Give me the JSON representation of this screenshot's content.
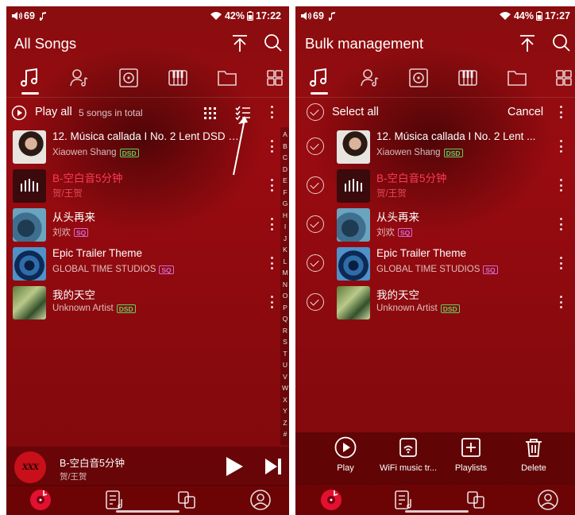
{
  "left": {
    "status": {
      "volume": "69",
      "battery": "42%",
      "time": "17:22"
    },
    "title": "All Songs",
    "subbar": {
      "play_all": "Play all",
      "count": "5 songs in total"
    },
    "songs": [
      {
        "title": "12. Música callada I No. 2  Lent DSD 5...",
        "artist": "Xiaowen Shang",
        "badge": "DSD",
        "playing": false
      },
      {
        "title": "B-空白音5分钟",
        "artist": "贺/王贺",
        "badge": "",
        "playing": true
      },
      {
        "title": "从头再来",
        "artist": "刘欢",
        "badge": "SQ",
        "playing": false
      },
      {
        "title": "Epic Trailer Theme",
        "artist": "GLOBAL TIME STUDIOS",
        "badge": "SQ",
        "playing": false
      },
      {
        "title": "我的天空",
        "artist": "Unknown Artist",
        "badge": "DSD",
        "playing": false
      }
    ],
    "alphabet": [
      "A",
      "B",
      "C",
      "D",
      "E",
      "F",
      "G",
      "H",
      "I",
      "J",
      "K",
      "L",
      "M",
      "N",
      "O",
      "P",
      "Q",
      "R",
      "S",
      "T",
      "U",
      "V",
      "W",
      "X",
      "Y",
      "Z",
      "#"
    ],
    "mini_player": {
      "title": "B-空白音5分钟",
      "artist": "贺/王贺",
      "art_text": "XXX"
    }
  },
  "right": {
    "status": {
      "volume": "69",
      "battery": "44%",
      "time": "17:27"
    },
    "title": "Bulk management",
    "subbar": {
      "select_all": "Select all",
      "cancel": "Cancel"
    },
    "songs": [
      {
        "title": "12. Música callada I No. 2  Lent ...",
        "artist": "Xiaowen Shang",
        "badge": "DSD",
        "playing": false
      },
      {
        "title": "B-空白音5分钟",
        "artist": "贺/王贺",
        "badge": "",
        "playing": true
      },
      {
        "title": "从头再来",
        "artist": "刘欢",
        "badge": "SQ",
        "playing": false
      },
      {
        "title": "Epic Trailer Theme",
        "artist": "GLOBAL TIME STUDIOS",
        "badge": "SQ",
        "playing": false
      },
      {
        "title": "我的天空",
        "artist": "Unknown Artist",
        "badge": "DSD",
        "playing": false
      }
    ],
    "actions": [
      {
        "label": "Play",
        "icon": "play-circle-icon"
      },
      {
        "label": "WiFi music tr...",
        "icon": "wifi-transfer-icon"
      },
      {
        "label": "Playlists",
        "icon": "add-playlist-icon"
      },
      {
        "label": "Delete",
        "icon": "trash-icon"
      }
    ]
  },
  "colors": {
    "background": "#8a0d0f",
    "playing": "#ff3b55",
    "dsd_badge": "#5fd05f",
    "sq_badge": "#d36ad8"
  }
}
